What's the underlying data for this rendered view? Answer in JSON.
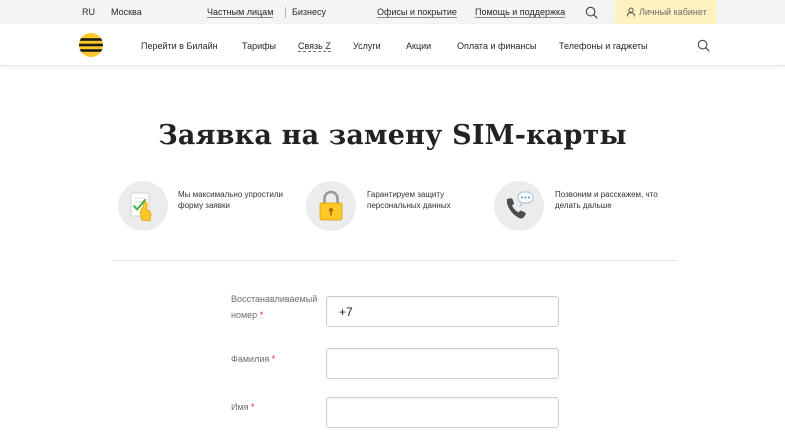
{
  "topbar": {
    "lang": "RU",
    "city": "Москва",
    "segment_private": "Частным лицам",
    "segment_business": "Бизнесу",
    "offices": "Офисы и покрытие",
    "help": "Помощь и поддержка",
    "cabinet": "Личный кабинет"
  },
  "nav": {
    "items": [
      "Перейти в Билайн",
      "Тарифы",
      "Связь Z",
      "Услуги",
      "Акции",
      "Оплата и финансы",
      "Телефоны и гаджеты"
    ]
  },
  "page": {
    "title": "Заявка на замену SIM-карты"
  },
  "features": [
    {
      "icon": "form-hand-icon",
      "text": "Мы максимально упростили форму заявки"
    },
    {
      "icon": "lock-icon",
      "text": "Гарантируем защиту персональных данных"
    },
    {
      "icon": "phone-chat-icon",
      "text": "Позвоним и расскажем, что делать дальше"
    }
  ],
  "form": {
    "phone_label": "Восстанавливаемый номер",
    "phone_value": "+7",
    "lastname_label": "Фамилия",
    "lastname_value": "",
    "firstname_label": "Имя",
    "firstname_value": "",
    "required_mark": "*"
  },
  "colors": {
    "brand_yellow": "#ffc828",
    "cabinet_bg": "#fef3c0",
    "required_red": "#e6282c"
  }
}
